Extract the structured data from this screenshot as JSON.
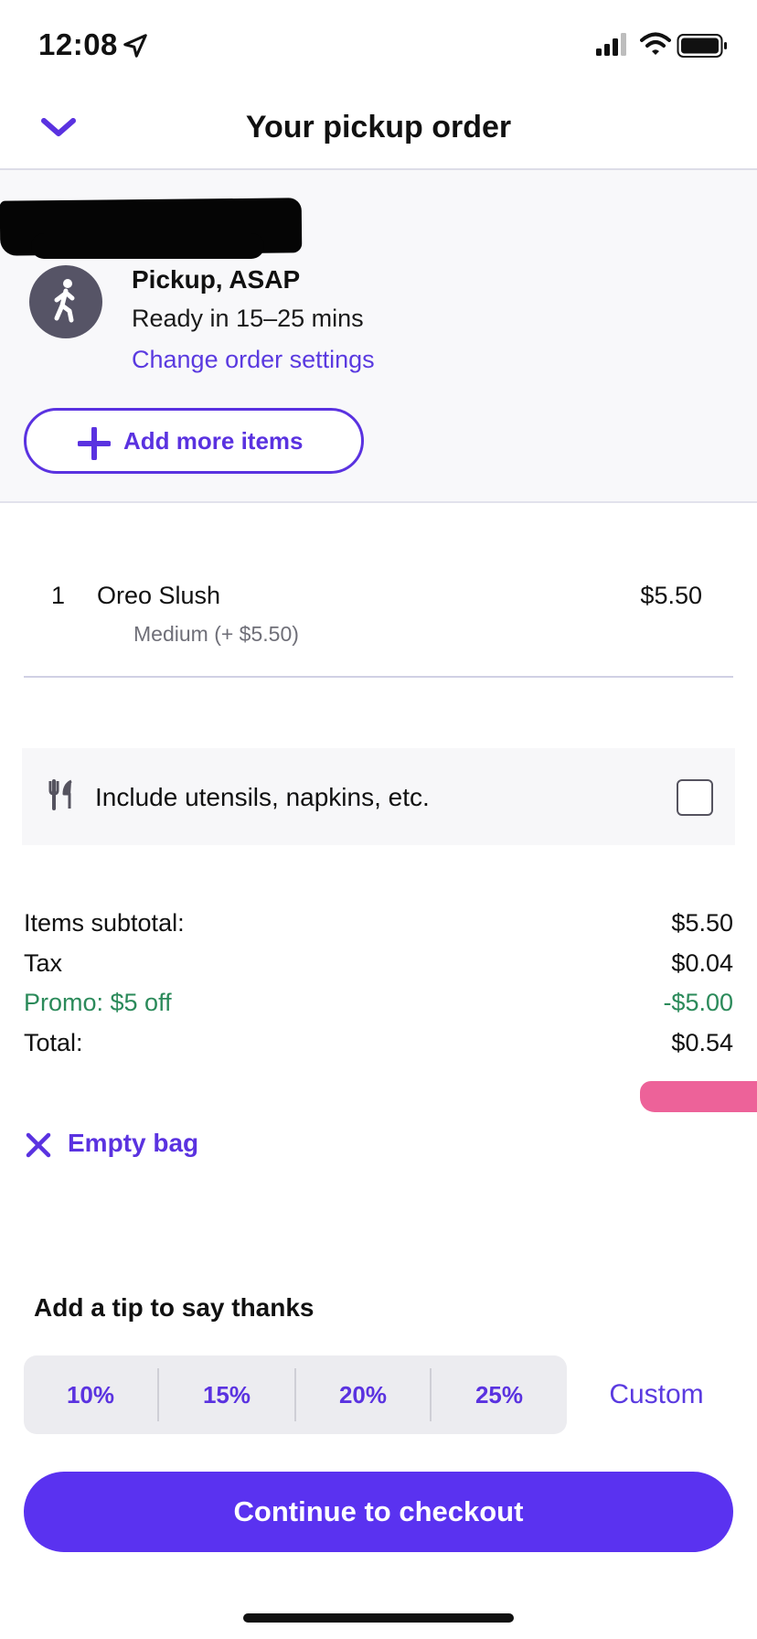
{
  "status_bar": {
    "time": "12:08"
  },
  "header": {
    "title": "Your pickup order"
  },
  "store": {
    "pickup_title": "Pickup, ASAP",
    "ready_text": "Ready in 15–25 mins",
    "change_link": "Change order settings",
    "add_more_label": "Add more items"
  },
  "items": [
    {
      "qty": "1",
      "name": "Oreo Slush",
      "price": "$5.50",
      "option": "Medium (+ $5.50)"
    }
  ],
  "utensils": {
    "label": "Include utensils, napkins, etc.",
    "checked": false
  },
  "totals": {
    "subtotal_label": "Items subtotal:",
    "subtotal_value": "$5.50",
    "tax_label": "Tax",
    "tax_value": "$0.04",
    "promo_label": "Promo: $5 off",
    "promo_value": "-$5.00",
    "total_label": "Total:",
    "total_value": "$0.54"
  },
  "empty_bag_label": "Empty bag",
  "tip": {
    "title": "Add a tip to say thanks",
    "options": [
      "10%",
      "15%",
      "20%",
      "25%"
    ],
    "custom_label": "Custom"
  },
  "checkout_label": "Continue to checkout",
  "colors": {
    "accent": "#5a32f0",
    "promo": "#2b8a5a",
    "section_bg": "#f8f8fa"
  }
}
